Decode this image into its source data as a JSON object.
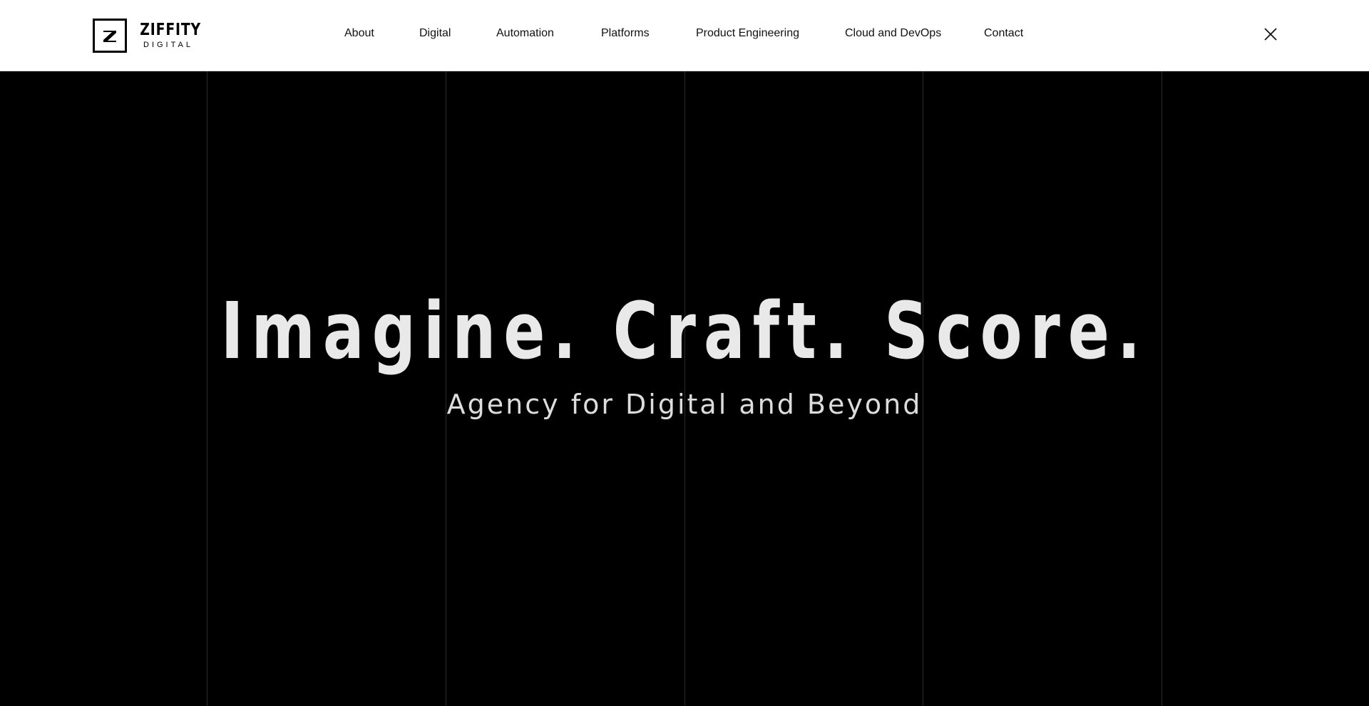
{
  "brand": {
    "name": "ZIFFITY",
    "tagline": "DIGITAL",
    "mark": "Z"
  },
  "nav": {
    "items": [
      {
        "label": "About"
      },
      {
        "label": "Digital"
      },
      {
        "label": "Automation"
      },
      {
        "label": "Platforms"
      },
      {
        "label": "Product Engineering"
      },
      {
        "label": "Cloud and DevOps"
      },
      {
        "label": "Contact"
      }
    ],
    "close_icon": "close-icon"
  },
  "hero": {
    "headline": "Imagine. Craft. Score.",
    "subheadline": "Agency for Digital and Beyond"
  },
  "colors": {
    "header_bg": "#ffffff",
    "hero_bg": "#000000",
    "hero_text": "#e9e9e9",
    "grid_line": "#2a2a2a"
  }
}
